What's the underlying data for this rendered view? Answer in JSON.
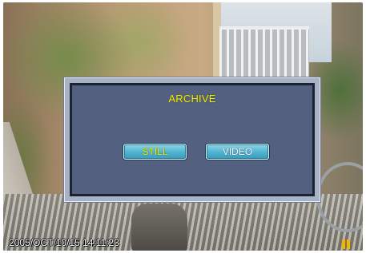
{
  "dialog": {
    "title": "ARCHIVE",
    "buttons": [
      {
        "label": "STILL",
        "selected": true
      },
      {
        "label": "VIDEO",
        "selected": false
      }
    ]
  },
  "overlay": {
    "timestamp": "2005/OCT/10/15 14:11:23",
    "status_icon": "pause-icon"
  },
  "colors": {
    "title_text": "#f2ef00",
    "selected_text": "#f2ef00",
    "unselected_text": "#ffffff",
    "dialog_panel": "#536080",
    "button_fill": "#4fb2cf",
    "pause_icon": "#f2b600"
  }
}
